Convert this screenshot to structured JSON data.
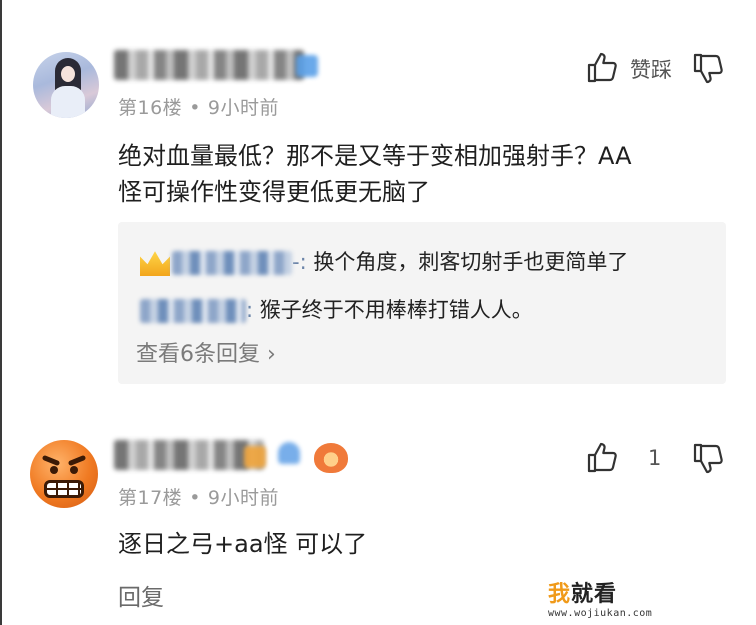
{
  "comments": [
    {
      "floor": "第16楼",
      "time": "9小时前",
      "text_lines": [
        "绝对血量最低？那不是又等于变相加强射手？AA",
        "怪可操作性变得更低更无脑了"
      ],
      "like_label": "赞踩",
      "replies": [
        {
          "name_tail": "-:",
          "text": "换个角度，刺客切射手也更简单了"
        },
        {
          "name_tail": ":",
          "text": "猴子终于不用棒棒打错人人。"
        }
      ],
      "view_more": "查看6条回复"
    },
    {
      "floor": "第17楼",
      "time": "9小时前",
      "text": "逐日之弓+aa怪 可以了",
      "like_count": "1",
      "reply_label": "回复"
    }
  ],
  "separator": "•",
  "chevron": "›",
  "watermark": {
    "main_wo": "我",
    "main_rest": "就看",
    "sub": "www.wojiukan.com"
  },
  "icons": [
    "thumb-up-icon",
    "thumb-down-icon",
    "crown-icon",
    "game-controller-icon"
  ],
  "colors": {
    "reply_bg": "#f4f4f4",
    "meta": "#9a9a9a",
    "watermark_accent": "#f09a1a"
  }
}
